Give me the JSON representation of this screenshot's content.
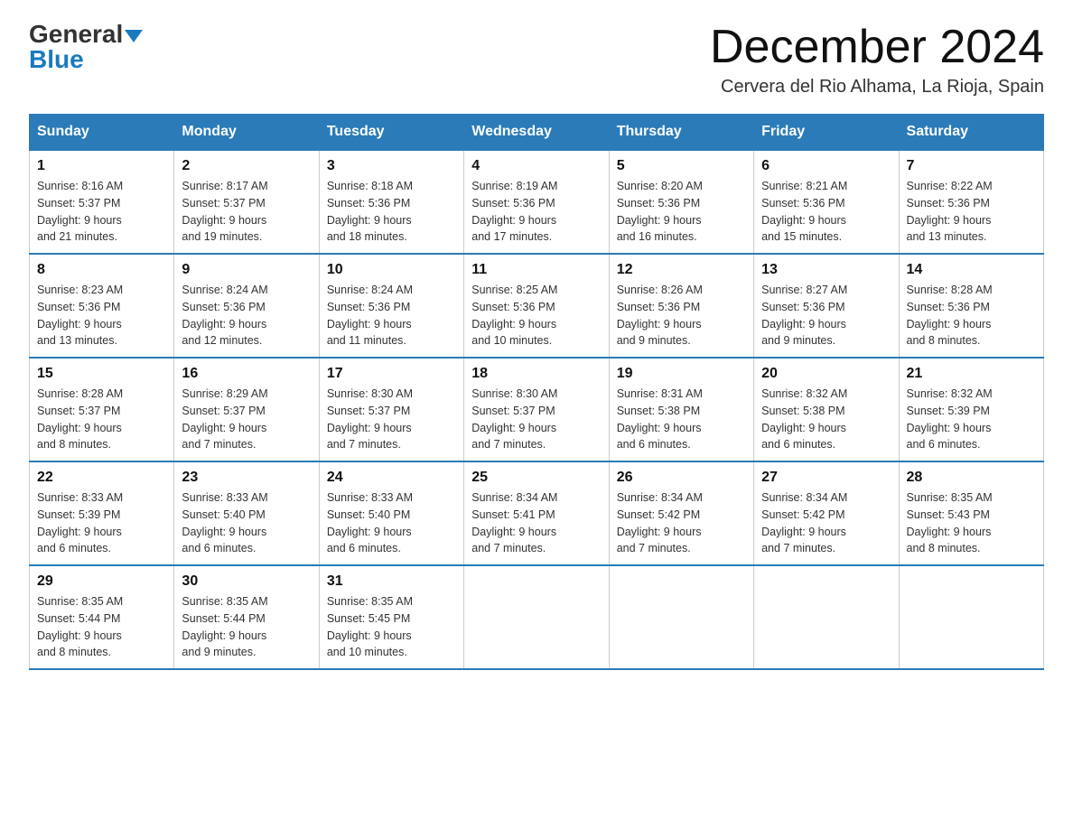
{
  "logo": {
    "general": "General",
    "blue": "Blue"
  },
  "header": {
    "month": "December 2024",
    "location": "Cervera del Rio Alhama, La Rioja, Spain"
  },
  "days_of_week": [
    "Sunday",
    "Monday",
    "Tuesday",
    "Wednesday",
    "Thursday",
    "Friday",
    "Saturday"
  ],
  "weeks": [
    [
      {
        "day": 1,
        "sunrise": "8:16 AM",
        "sunset": "5:37 PM",
        "daylight": "9 hours and 21 minutes."
      },
      {
        "day": 2,
        "sunrise": "8:17 AM",
        "sunset": "5:37 PM",
        "daylight": "9 hours and 19 minutes."
      },
      {
        "day": 3,
        "sunrise": "8:18 AM",
        "sunset": "5:36 PM",
        "daylight": "9 hours and 18 minutes."
      },
      {
        "day": 4,
        "sunrise": "8:19 AM",
        "sunset": "5:36 PM",
        "daylight": "9 hours and 17 minutes."
      },
      {
        "day": 5,
        "sunrise": "8:20 AM",
        "sunset": "5:36 PM",
        "daylight": "9 hours and 16 minutes."
      },
      {
        "day": 6,
        "sunrise": "8:21 AM",
        "sunset": "5:36 PM",
        "daylight": "9 hours and 15 minutes."
      },
      {
        "day": 7,
        "sunrise": "8:22 AM",
        "sunset": "5:36 PM",
        "daylight": "9 hours and 13 minutes."
      }
    ],
    [
      {
        "day": 8,
        "sunrise": "8:23 AM",
        "sunset": "5:36 PM",
        "daylight": "9 hours and 13 minutes."
      },
      {
        "day": 9,
        "sunrise": "8:24 AM",
        "sunset": "5:36 PM",
        "daylight": "9 hours and 12 minutes."
      },
      {
        "day": 10,
        "sunrise": "8:24 AM",
        "sunset": "5:36 PM",
        "daylight": "9 hours and 11 minutes."
      },
      {
        "day": 11,
        "sunrise": "8:25 AM",
        "sunset": "5:36 PM",
        "daylight": "9 hours and 10 minutes."
      },
      {
        "day": 12,
        "sunrise": "8:26 AM",
        "sunset": "5:36 PM",
        "daylight": "9 hours and 9 minutes."
      },
      {
        "day": 13,
        "sunrise": "8:27 AM",
        "sunset": "5:36 PM",
        "daylight": "9 hours and 9 minutes."
      },
      {
        "day": 14,
        "sunrise": "8:28 AM",
        "sunset": "5:36 PM",
        "daylight": "9 hours and 8 minutes."
      }
    ],
    [
      {
        "day": 15,
        "sunrise": "8:28 AM",
        "sunset": "5:37 PM",
        "daylight": "9 hours and 8 minutes."
      },
      {
        "day": 16,
        "sunrise": "8:29 AM",
        "sunset": "5:37 PM",
        "daylight": "9 hours and 7 minutes."
      },
      {
        "day": 17,
        "sunrise": "8:30 AM",
        "sunset": "5:37 PM",
        "daylight": "9 hours and 7 minutes."
      },
      {
        "day": 18,
        "sunrise": "8:30 AM",
        "sunset": "5:37 PM",
        "daylight": "9 hours and 7 minutes."
      },
      {
        "day": 19,
        "sunrise": "8:31 AM",
        "sunset": "5:38 PM",
        "daylight": "9 hours and 6 minutes."
      },
      {
        "day": 20,
        "sunrise": "8:32 AM",
        "sunset": "5:38 PM",
        "daylight": "9 hours and 6 minutes."
      },
      {
        "day": 21,
        "sunrise": "8:32 AM",
        "sunset": "5:39 PM",
        "daylight": "9 hours and 6 minutes."
      }
    ],
    [
      {
        "day": 22,
        "sunrise": "8:33 AM",
        "sunset": "5:39 PM",
        "daylight": "9 hours and 6 minutes."
      },
      {
        "day": 23,
        "sunrise": "8:33 AM",
        "sunset": "5:40 PM",
        "daylight": "9 hours and 6 minutes."
      },
      {
        "day": 24,
        "sunrise": "8:33 AM",
        "sunset": "5:40 PM",
        "daylight": "9 hours and 6 minutes."
      },
      {
        "day": 25,
        "sunrise": "8:34 AM",
        "sunset": "5:41 PM",
        "daylight": "9 hours and 7 minutes."
      },
      {
        "day": 26,
        "sunrise": "8:34 AM",
        "sunset": "5:42 PM",
        "daylight": "9 hours and 7 minutes."
      },
      {
        "day": 27,
        "sunrise": "8:34 AM",
        "sunset": "5:42 PM",
        "daylight": "9 hours and 7 minutes."
      },
      {
        "day": 28,
        "sunrise": "8:35 AM",
        "sunset": "5:43 PM",
        "daylight": "9 hours and 8 minutes."
      }
    ],
    [
      {
        "day": 29,
        "sunrise": "8:35 AM",
        "sunset": "5:44 PM",
        "daylight": "9 hours and 8 minutes."
      },
      {
        "day": 30,
        "sunrise": "8:35 AM",
        "sunset": "5:44 PM",
        "daylight": "9 hours and 9 minutes."
      },
      {
        "day": 31,
        "sunrise": "8:35 AM",
        "sunset": "5:45 PM",
        "daylight": "9 hours and 10 minutes."
      },
      null,
      null,
      null,
      null
    ]
  ],
  "cell_labels": {
    "sunrise": "Sunrise:",
    "sunset": "Sunset:",
    "daylight": "Daylight:"
  }
}
